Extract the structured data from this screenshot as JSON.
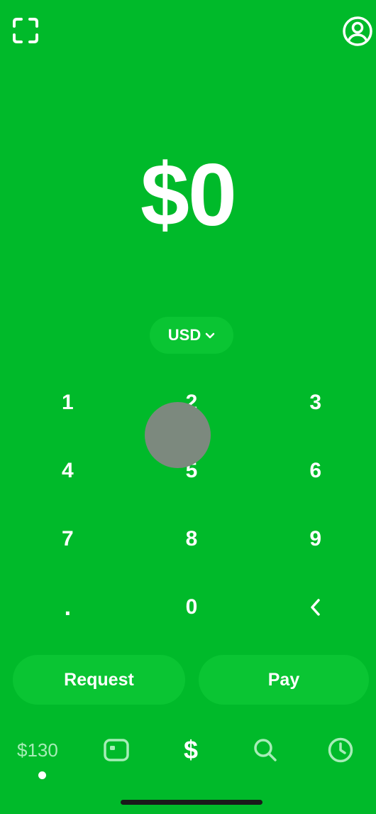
{
  "amount": "$0",
  "currency": {
    "label": "USD",
    "chevron_icon": "chevron-down-icon"
  },
  "keypad": {
    "keys": [
      "1",
      "2",
      "3",
      "4",
      "5",
      "6",
      "7",
      "8",
      "9",
      ".",
      "0"
    ],
    "backspace_icon": "chevron-left-icon"
  },
  "actions": {
    "request_label": "Request",
    "pay_label": "Pay"
  },
  "nav": {
    "balance": "$130",
    "dollar_glyph": "$",
    "icons": [
      "card-icon",
      "dollar-icon",
      "search-icon",
      "clock-icon"
    ]
  },
  "colors": {
    "background": "#00BA2A",
    "pill": "#0AC533",
    "nav_muted": "#A6EDB7"
  },
  "top_bar": {
    "left_icon": "scan-icon",
    "right_icon": "profile-icon"
  }
}
